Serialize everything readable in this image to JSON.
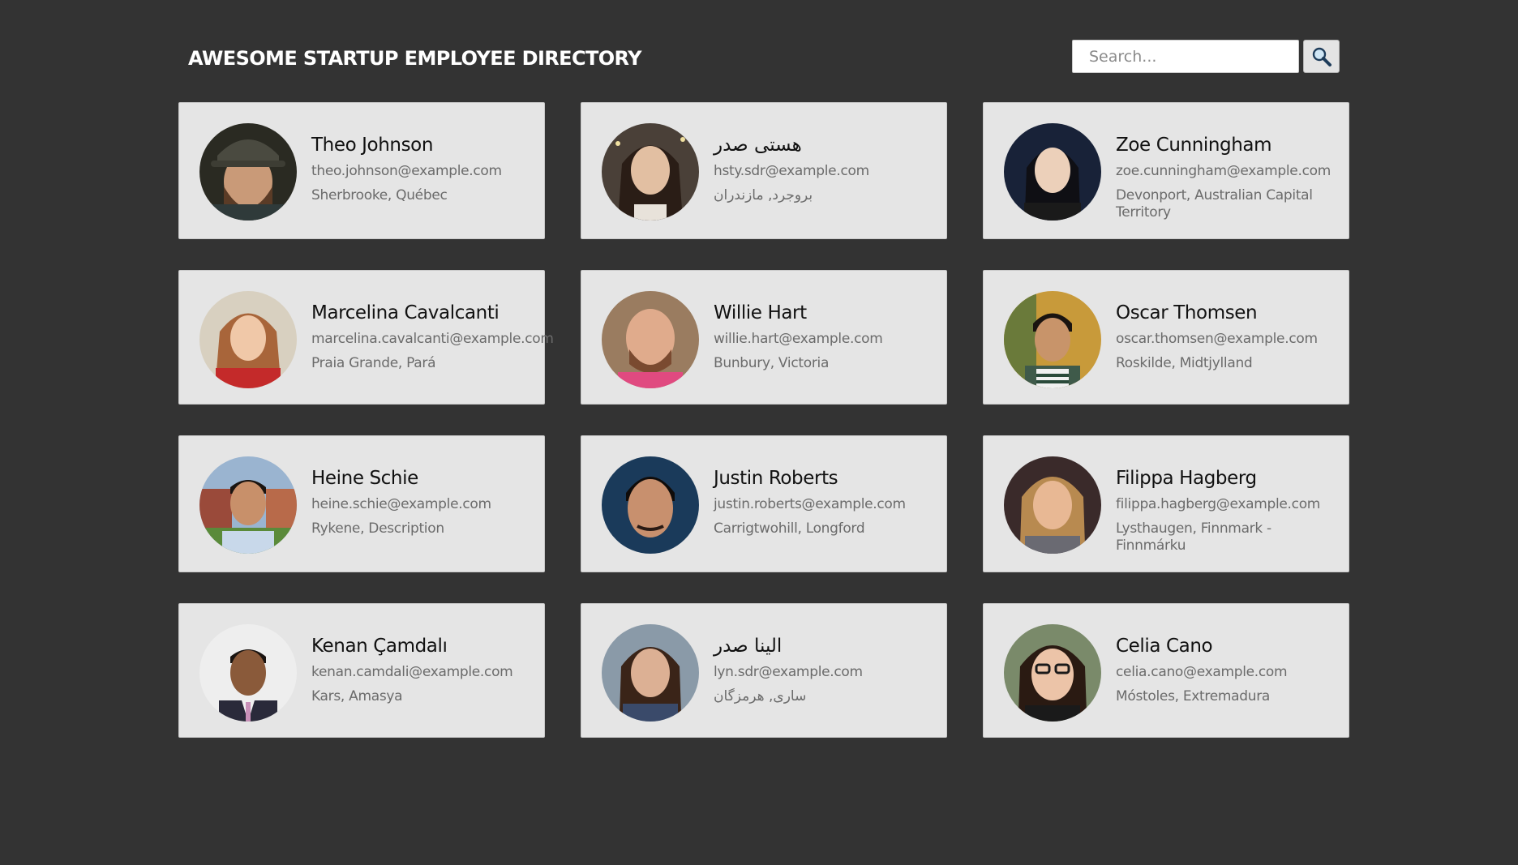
{
  "header": {
    "title": "AWESOME STARTUP EMPLOYEE DIRECTORY",
    "search_placeholder": "Search...",
    "search_icon": "search-icon"
  },
  "employees": [
    {
      "name": "Theo Johnson",
      "email": "theo.johnson@example.com",
      "location": "Sherbrooke, Québec"
    },
    {
      "name": "هستی صدر",
      "email": "hsty.sdr@example.com",
      "location": "بروجرد, مازندران"
    },
    {
      "name": "Zoe Cunningham",
      "email": "zoe.cunningham@example.com",
      "location": "Devonport, Australian Capital Territory"
    },
    {
      "name": "Marcelina Cavalcanti",
      "email": "marcelina.cavalcanti@example.com",
      "location": "Praia Grande, Pará"
    },
    {
      "name": "Willie Hart",
      "email": "willie.hart@example.com",
      "location": "Bunbury, Victoria"
    },
    {
      "name": "Oscar Thomsen",
      "email": "oscar.thomsen@example.com",
      "location": "Roskilde, Midtjylland"
    },
    {
      "name": "Heine Schie",
      "email": "heine.schie@example.com",
      "location": "Rykene, Description"
    },
    {
      "name": "Justin Roberts",
      "email": "justin.roberts@example.com",
      "location": "Carrigtwohill, Longford"
    },
    {
      "name": "Filippa Hagberg",
      "email": "filippa.hagberg@example.com",
      "location": "Lysthaugen, Finnmark - Finnmárku"
    },
    {
      "name": "Kenan Çamdalı",
      "email": "kenan.camdali@example.com",
      "location": "Kars, Amasya"
    },
    {
      "name": "الینا صدر",
      "email": "lyn.sdr@example.com",
      "location": "ساری, هرمزگان"
    },
    {
      "name": "Celia Cano",
      "email": "celia.cano@example.com",
      "location": "Móstoles, Extremadura"
    }
  ],
  "colors": {
    "background": "#333333",
    "card": "#e5e5e5",
    "card_border": "#c9c9c9",
    "title": "#ffffff",
    "name": "#111111",
    "secondary_text": "#6b6b6b"
  }
}
